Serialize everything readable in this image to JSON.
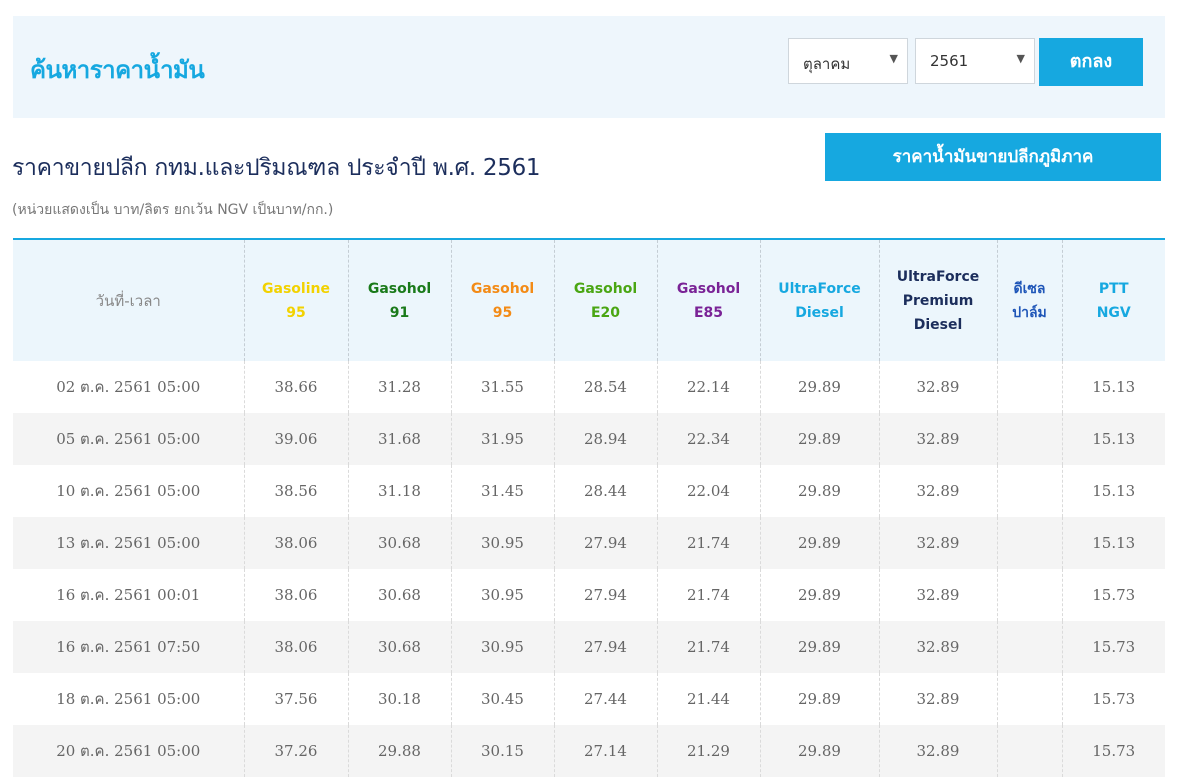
{
  "search": {
    "title": "ค้นหาราคาน้ำมัน",
    "month_value": "ตุลาคม",
    "year_value": "2561",
    "submit_label": "ตกลง"
  },
  "heading": {
    "title": "ราคาขายปลีก กทม.และปริมณฑล ประจำปี พ.ศ. 2561",
    "unit_note": "(หน่วยแสดงเป็น บาท/ลิตร ยกเว้น NGV เป็นบาท/กก.)",
    "region_button_label": "ราคาน้ำมันขายปลีกภูมิภาค"
  },
  "colors": {
    "accent": "#16a8e0",
    "gasoline95": "#f2d200",
    "gasohol91": "#1a7a1a",
    "gasohol95": "#f38b16",
    "gasohole20": "#4aa613",
    "gasohole85": "#7a2396",
    "ultraforce_diesel": "#16a8e0",
    "ultraforce_premium": "#1c2e5c",
    "palm_diesel": "#1f56b8",
    "ngv": "#16a8e0"
  },
  "table": {
    "headers": [
      {
        "lines": [
          "วันที่-เวลา"
        ],
        "color": "#888888"
      },
      {
        "lines": [
          "Gasoline",
          "95"
        ],
        "color": "#f2d200"
      },
      {
        "lines": [
          "Gasohol",
          "91"
        ],
        "color": "#1a7a1a"
      },
      {
        "lines": [
          "Gasohol",
          "95"
        ],
        "color": "#f38b16"
      },
      {
        "lines": [
          "Gasohol",
          "E20"
        ],
        "color": "#4aa613"
      },
      {
        "lines": [
          "Gasohol",
          "E85"
        ],
        "color": "#7a2396"
      },
      {
        "lines": [
          "UltraForce",
          "Diesel"
        ],
        "color": "#16a8e0"
      },
      {
        "lines": [
          "UltraForce",
          "Premium",
          "Diesel"
        ],
        "color": "#1c2e5c"
      },
      {
        "lines": [
          "ดีเซล",
          "ปาล์ม"
        ],
        "color": "#1f56b8"
      },
      {
        "lines": [
          "PTT",
          "NGV"
        ],
        "color": "#16a8e0"
      }
    ],
    "rows": [
      [
        "02 ต.ค. 2561 05:00",
        "38.66",
        "31.28",
        "31.55",
        "28.54",
        "22.14",
        "29.89",
        "32.89",
        "",
        "15.13"
      ],
      [
        "05 ต.ค. 2561 05:00",
        "39.06",
        "31.68",
        "31.95",
        "28.94",
        "22.34",
        "29.89",
        "32.89",
        "",
        "15.13"
      ],
      [
        "10 ต.ค. 2561 05:00",
        "38.56",
        "31.18",
        "31.45",
        "28.44",
        "22.04",
        "29.89",
        "32.89",
        "",
        "15.13"
      ],
      [
        "13 ต.ค. 2561 05:00",
        "38.06",
        "30.68",
        "30.95",
        "27.94",
        "21.74",
        "29.89",
        "32.89",
        "",
        "15.13"
      ],
      [
        "16 ต.ค. 2561 00:01",
        "38.06",
        "30.68",
        "30.95",
        "27.94",
        "21.74",
        "29.89",
        "32.89",
        "",
        "15.73"
      ],
      [
        "16 ต.ค. 2561 07:50",
        "38.06",
        "30.68",
        "30.95",
        "27.94",
        "21.74",
        "29.89",
        "32.89",
        "",
        "15.73"
      ],
      [
        "18 ต.ค. 2561 05:00",
        "37.56",
        "30.18",
        "30.45",
        "27.44",
        "21.44",
        "29.89",
        "32.89",
        "",
        "15.73"
      ],
      [
        "20 ต.ค. 2561 05:00",
        "37.26",
        "29.88",
        "30.15",
        "27.14",
        "21.29",
        "29.89",
        "32.89",
        "",
        "15.73"
      ]
    ]
  }
}
